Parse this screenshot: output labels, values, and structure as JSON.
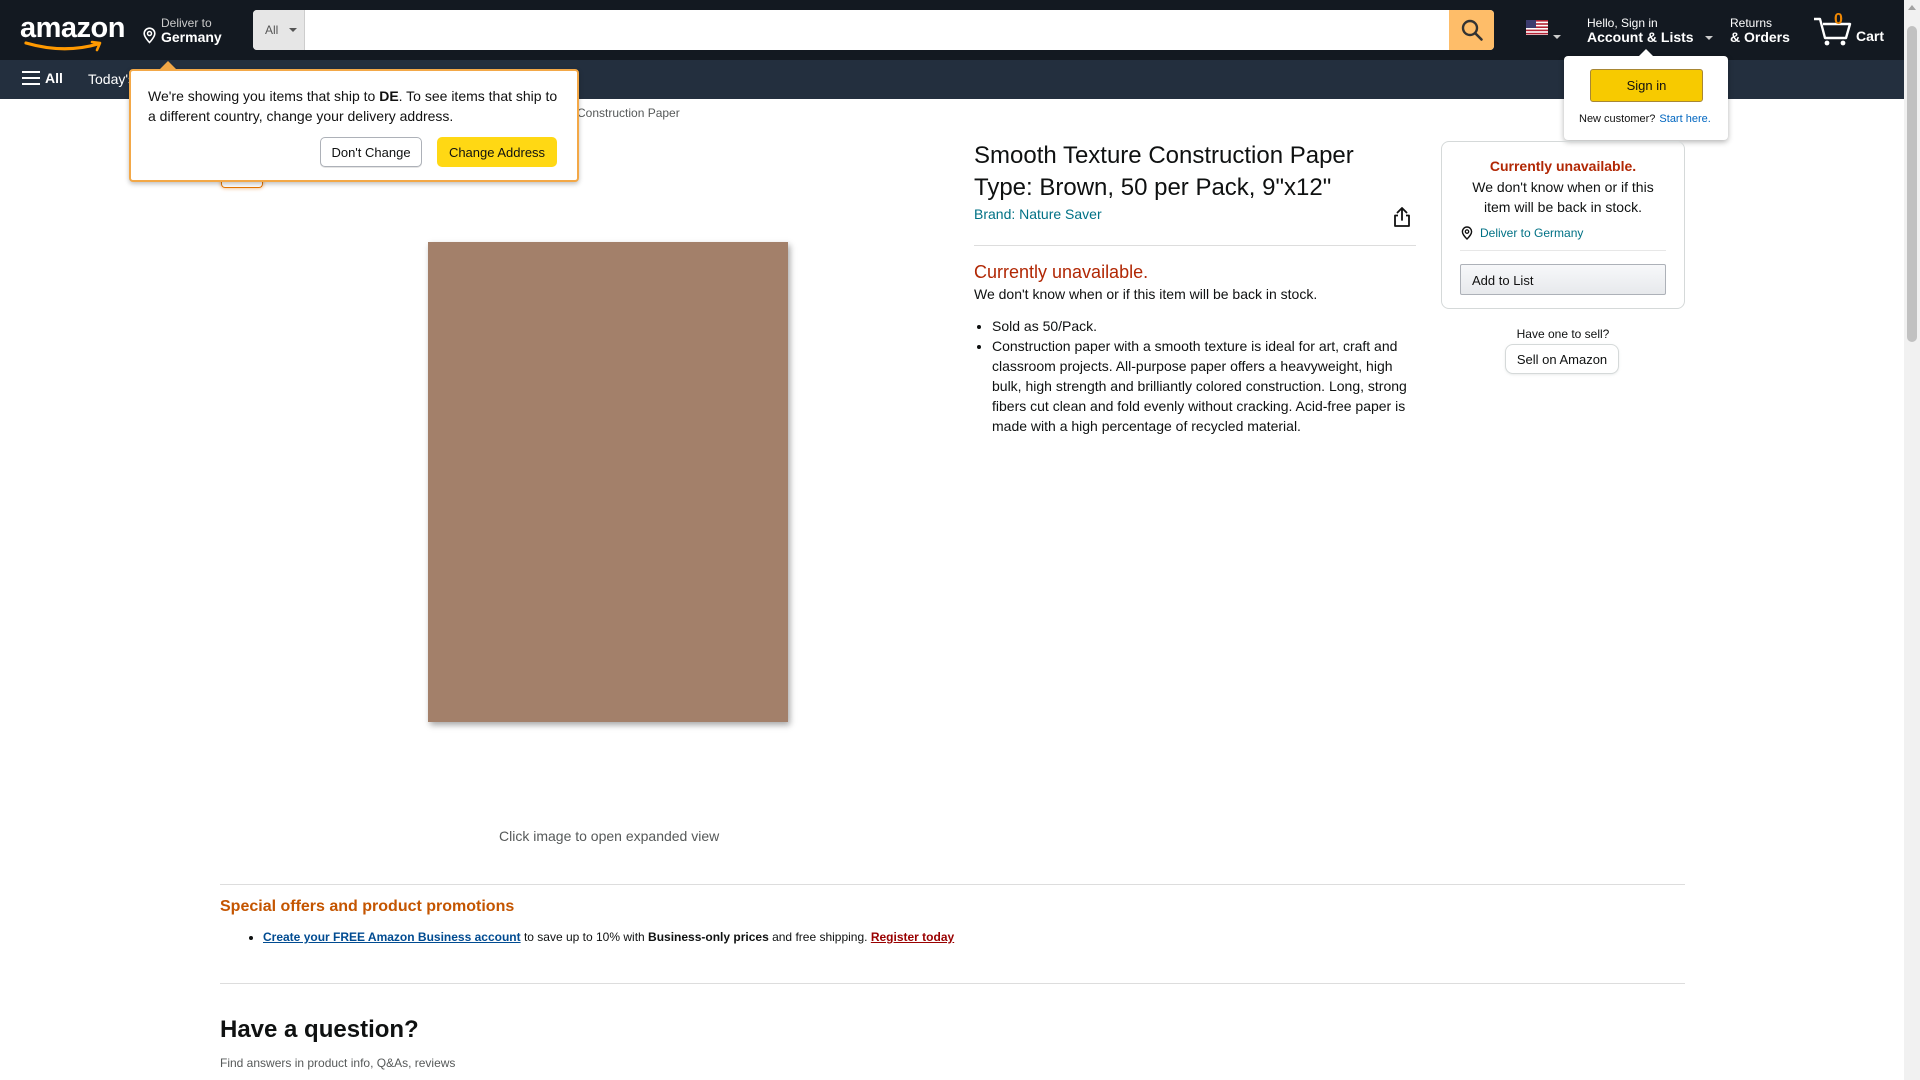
{
  "nav": {
    "logo_text": "amazon",
    "deliver_line1": "Deliver to",
    "deliver_line2": "Germany",
    "search_category": "All",
    "search_placeholder": "",
    "account_line1": "Hello, Sign in",
    "account_line2": "Account & Lists",
    "returns_line1": "Returns",
    "returns_line2": "& Orders",
    "cart_count": "0",
    "cart_label": "Cart",
    "flag_icon": "us-flag-icon"
  },
  "subnav": {
    "all_label": "All",
    "today_label": "Today's"
  },
  "account_flyout": {
    "signin_label": "Sign in",
    "new_customer": "New customer?",
    "start_here": "Start here."
  },
  "location_popover": {
    "msg_part1": "We're showing you items that ship to ",
    "msg_country": "DE",
    "msg_part2": ". To see items that ship to a different country, change your delivery address.",
    "dont_change_label": "Don't Change",
    "change_address_label": "Change Address"
  },
  "breadcrumb": {
    "last": "Construction Paper"
  },
  "product": {
    "title": "Smooth Texture Construction Paper Type: Brown, 50 per Pack, 9\"x12\"",
    "brand": "Brand: Nature Saver",
    "unavailable": "Currently unavailable.",
    "unavailable_sub": "We don't know when or if this item will be back in stock.",
    "bullets": [
      "Sold as 50/Pack.",
      "Construction paper with a smooth texture is ideal for art, craft and classroom projects. All-purpose paper offers a heavyweight, high bulk, high strength and brilliantly colored construction. Long, strong fibers cut clean and fold evenly without cracking. Acid-free paper is made with a high percentage of recycled material."
    ],
    "image_hint": "Click image to open expanded view",
    "image_color": "#a3806a"
  },
  "buybox": {
    "unavailable": "Currently unavailable.",
    "unavailable_sub": "We don't know when or if this item will be back in stock.",
    "deliver_to": "Deliver to Germany",
    "add_to_list": "Add to List",
    "sell_question": "Have one to sell?",
    "sell_label": "Sell on Amazon"
  },
  "promotions": {
    "heading": "Special offers and product promotions",
    "link1": "Create your FREE Amazon Business account",
    "text1": " to save up to 10% with ",
    "bold1": "Business-only prices",
    "text2": " and free shipping. ",
    "link2": "Register today"
  },
  "questions": {
    "heading": "Have a question?",
    "sub": "Find answers in product info, Q&As, reviews"
  },
  "colors": {
    "nav_bg": "#131921",
    "subnav_bg": "#232f3e",
    "search_button": "#febd69",
    "price_red": "#b12704",
    "link_teal": "#007185",
    "promo_orange": "#c45500"
  }
}
